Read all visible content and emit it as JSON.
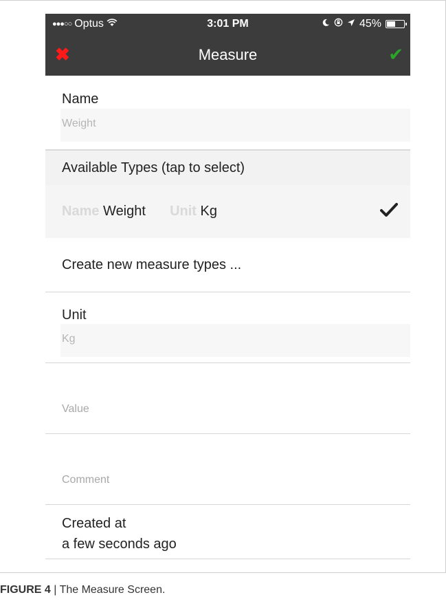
{
  "status_bar": {
    "signal_dots": "●●●○○",
    "carrier": "Optus",
    "wifi": "wifi-icon",
    "time": "3:01 PM",
    "battery_percent": "45%",
    "battery_level": 0.45,
    "icons": [
      "moon-icon",
      "rotation-lock-icon",
      "location-arrow-icon",
      "battery-icon"
    ]
  },
  "nav_bar": {
    "title": "Measure",
    "close_icon": "✖",
    "confirm_icon": "✔",
    "close_color": "#ff1a1a",
    "confirm_color": "#2aa52a"
  },
  "form": {
    "name_label": "Name",
    "name_value": "Weight",
    "types_header": "Available Types (tap to select)",
    "type_item": {
      "name_key": "Name",
      "name_value": "Weight",
      "unit_key": "Unit",
      "unit_value": "Kg",
      "selected": true
    },
    "create_new_label": "Create new measure types ...",
    "unit_label": "Unit",
    "unit_value": "Kg",
    "value_placeholder": "Value",
    "comment_placeholder": "Comment",
    "created_label": "Created at",
    "created_value": "a few seconds ago"
  },
  "caption": {
    "figure_label": "FIGURE 4",
    "separator": " | ",
    "text": "The Measure Screen."
  }
}
